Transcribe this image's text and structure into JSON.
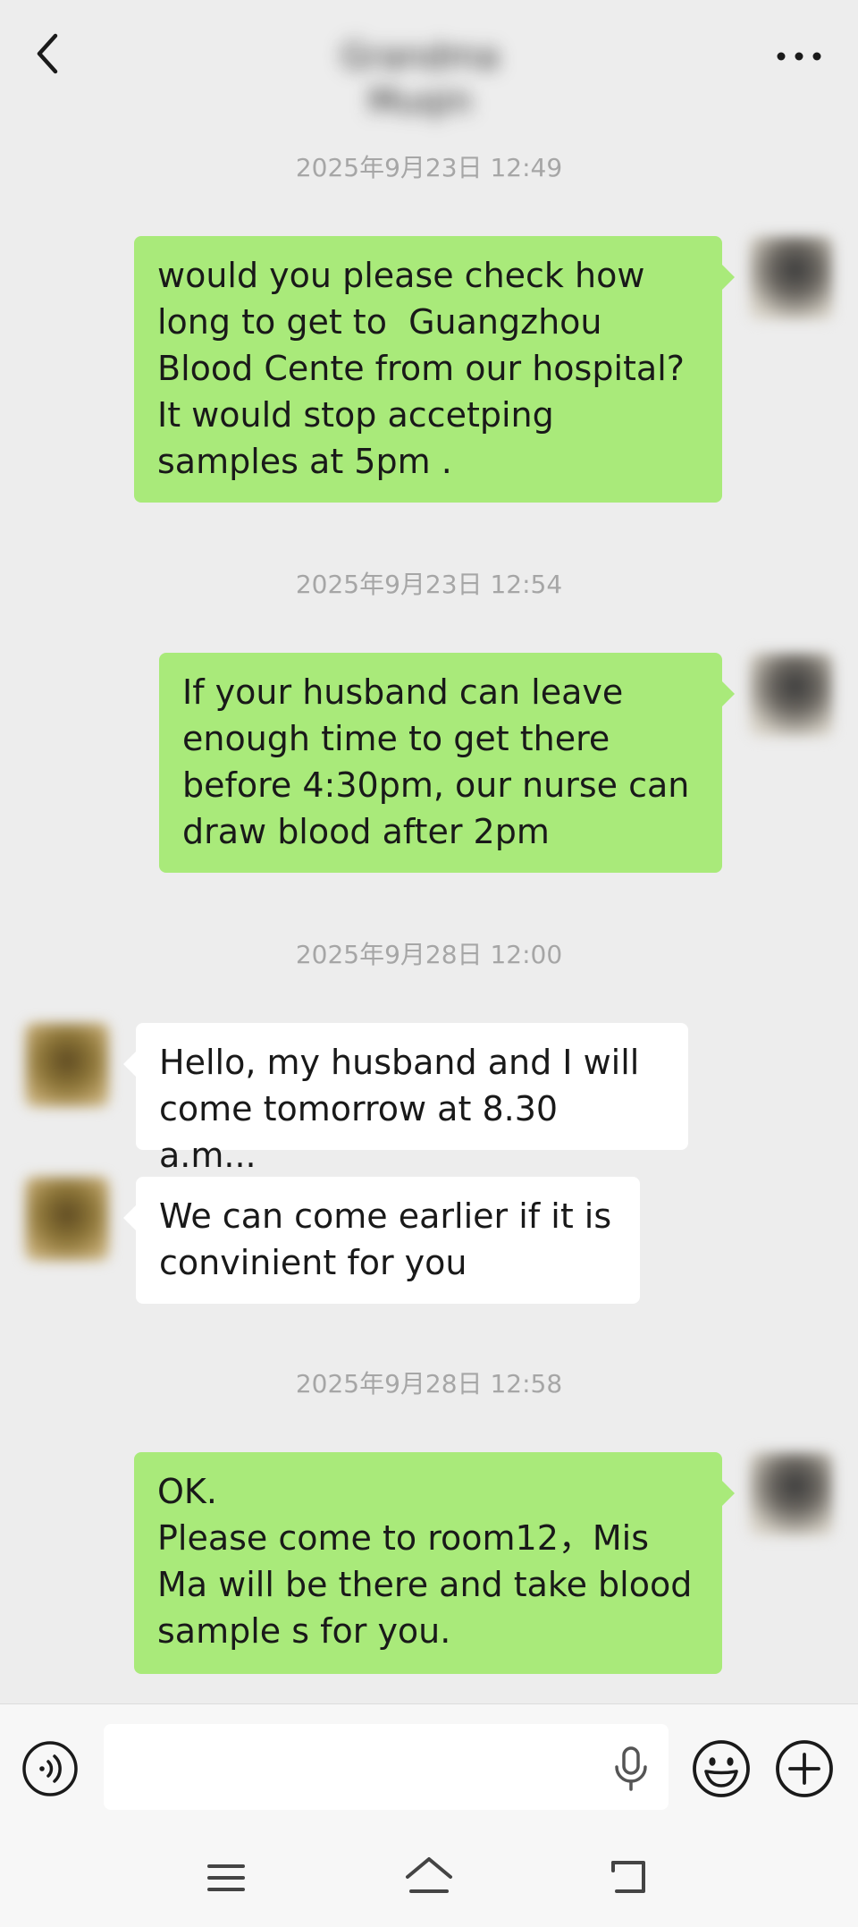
{
  "header": {
    "contact_name": "Grandma Muqin"
  },
  "messages": [
    {
      "timestamp": "2025年9月23日 12:49",
      "text": "would you please check how\nlong to get to  Guangzhou\nBlood Cente from our hospital?\nIt would stop accetping\nsamples at 5pm ."
    },
    {
      "timestamp": "2025年9月23日 12:54",
      "text": "If your husband can leave\nenough time to get there\nbefore 4:30pm, our nurse can\ndraw blood after 2pm"
    },
    {
      "timestamp": "2025年9月28日 12:00",
      "text": "Hello, my husband and I will\ncome tomorrow at 8.30 a.m..."
    },
    {
      "text": "We can come earlier if it is\nconvinient for you"
    },
    {
      "timestamp": "2025年9月28日 12:58",
      "text": "OK.\nPlease come to room12，Mis\nMa will be there and take blood\nsample s for you."
    }
  ],
  "input": {
    "value": ""
  },
  "icons": {
    "back": "chevron-left-icon",
    "more": "more-dots-icon",
    "voice": "voice-wave-icon",
    "mic": "microphone-icon",
    "emoji": "smiley-icon",
    "plus": "plus-circle-icon",
    "nav_menu": "menu-lines-icon",
    "nav_home": "home-icon",
    "nav_back": "return-icon"
  },
  "colors": {
    "background": "#ededed",
    "outgoing_bubble": "#a9ea7a",
    "incoming_bubble": "#ffffff",
    "timestamp_text": "#a6a6a6"
  }
}
